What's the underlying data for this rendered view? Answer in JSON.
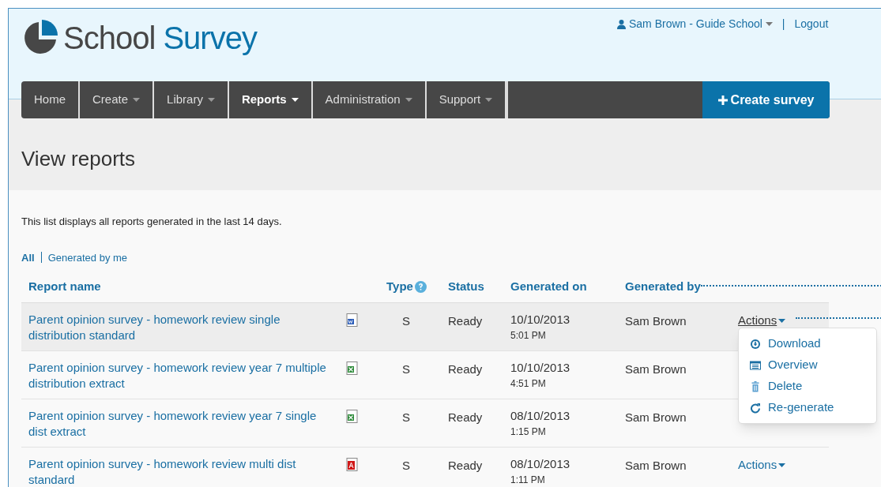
{
  "logo": {
    "word_1": "School",
    "word_2": "Survey"
  },
  "user_menu": {
    "label": "Sam Brown - Guide School",
    "separator": "|",
    "logout": "Logout"
  },
  "nav": [
    {
      "label": "Home",
      "selected": false,
      "caret": false
    },
    {
      "label": "Create",
      "selected": false,
      "caret": true
    },
    {
      "label": "Library",
      "selected": false,
      "caret": true
    },
    {
      "label": "Reports",
      "selected": true,
      "caret": true
    },
    {
      "label": "Administration",
      "selected": false,
      "caret": true
    },
    {
      "label": "Support",
      "selected": false,
      "caret": true
    }
  ],
  "create_button": "Create survey",
  "page_title": "View reports",
  "intro": "This list displays all reports generated in the last 14 days.",
  "filters": [
    {
      "label": "All",
      "selected": true
    },
    {
      "label": "Generated by me",
      "selected": false
    }
  ],
  "table": {
    "columns": [
      "Report name",
      "Type",
      "Status",
      "Generated on",
      "Generated by"
    ],
    "rows": [
      {
        "name": "Parent opinion survey - homework review single distribution standard",
        "kind": "word",
        "type": "S",
        "status": "Ready",
        "date": "10/10/2013",
        "time": "5:01 PM",
        "by": "Sam Brown",
        "actions": "Actions",
        "menu_open": true,
        "highlighted": true
      },
      {
        "name": "Parent opinion survey - homework review year 7 multiple distribution extract",
        "kind": "excel",
        "type": "S",
        "status": "Ready",
        "date": "10/10/2013",
        "time": "4:51 PM",
        "by": "Sam Brown",
        "highlighted": false
      },
      {
        "name": "Parent opinion survey - homework review year 7 single dist extract",
        "kind": "excel",
        "type": "S",
        "status": "Ready",
        "date": "08/10/2013",
        "time": "1:15 PM",
        "by": "Sam Brown",
        "highlighted": false
      },
      {
        "name": "Parent opinion survey - homework review multi dist standard",
        "kind": "pdf",
        "type": "S",
        "status": "Ready",
        "date": "08/10/2013",
        "time": "1:11 PM",
        "by": "Sam Brown",
        "actions": "Actions",
        "menu_open": false,
        "highlighted": false
      }
    ]
  },
  "actions_menu": [
    {
      "label": "Download",
      "kind": "download"
    },
    {
      "label": "Overview",
      "kind": "overview"
    },
    {
      "label": "Delete",
      "kind": "delete"
    },
    {
      "label": "Re-generate",
      "kind": "regenerate"
    }
  ]
}
